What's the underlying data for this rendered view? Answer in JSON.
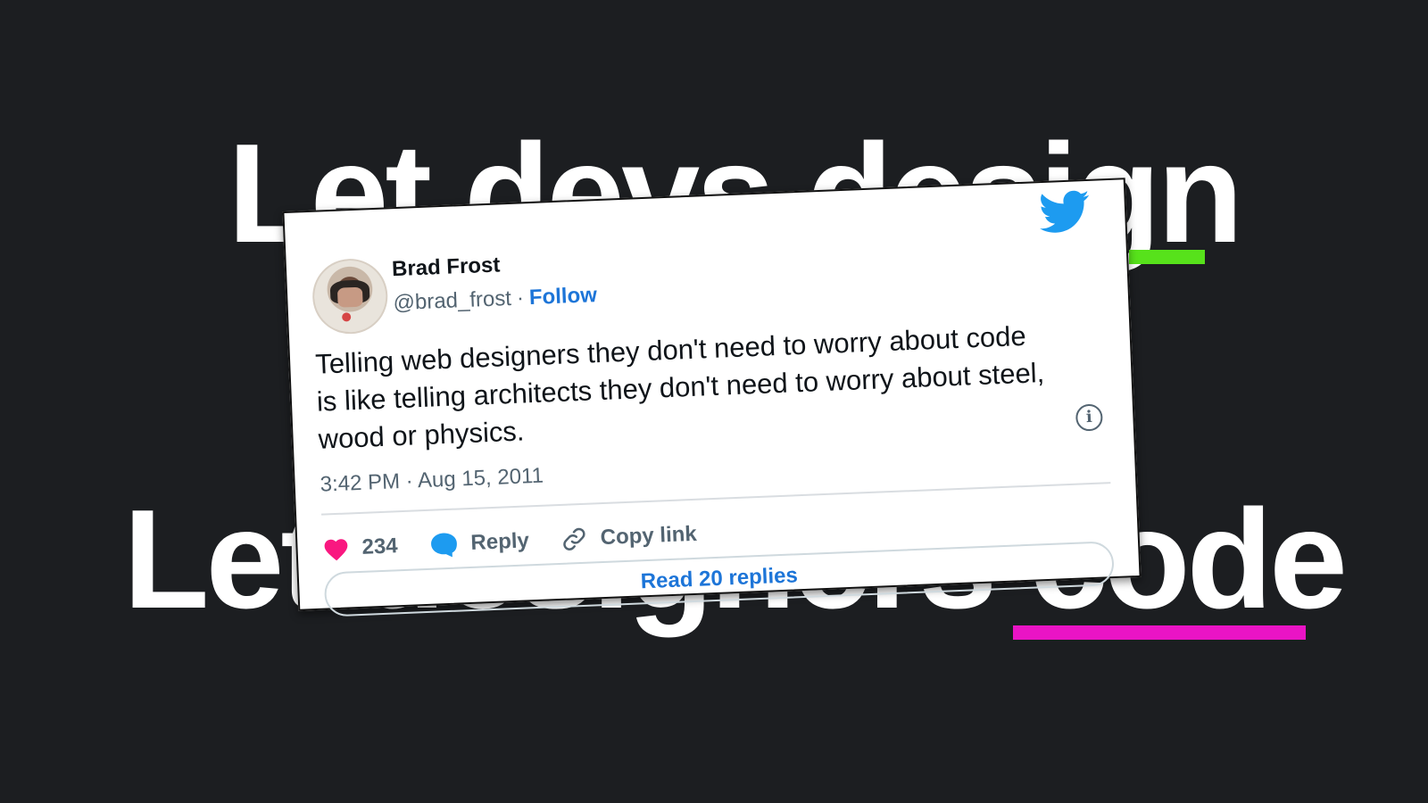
{
  "headlines": {
    "line1": "Let devs design",
    "line2": "Let designers code"
  },
  "accent_colors": {
    "background": "#1c1e21",
    "green_underline": "#57e21b",
    "magenta_underline": "#ea14c5",
    "link_blue": "#1d75d8",
    "heart_pink": "#f91880",
    "twitter_blue": "#1d9bf0"
  },
  "tweet": {
    "author_name": "Brad Frost",
    "handle": "@brad_frost",
    "separator": "·",
    "follow_label": "Follow",
    "text": "Telling web designers they don't need to worry about code is like telling architects they don't need to worry about steel, wood or physics.",
    "timestamp": "3:42 PM · Aug 15, 2011",
    "info_symbol": "i",
    "likes_count": "234",
    "reply_label": "Reply",
    "copy_link_label": "Copy link",
    "read_replies_label": "Read 20 replies",
    "icons": [
      "twitter-bird-icon",
      "info-icon",
      "heart-icon",
      "reply-bubble-icon",
      "link-icon"
    ]
  }
}
